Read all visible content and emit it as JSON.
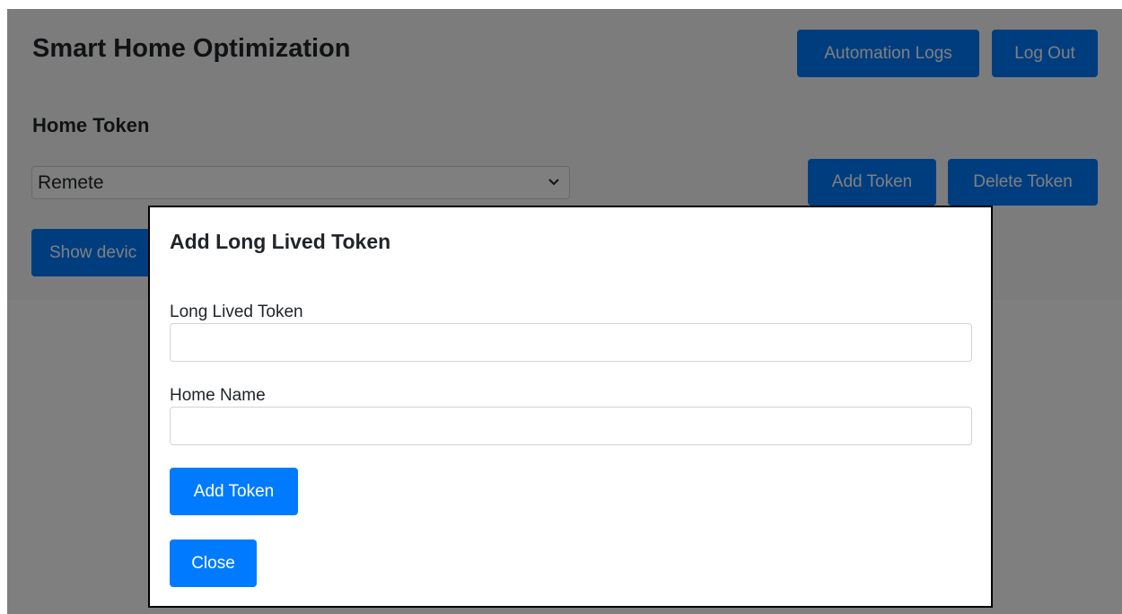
{
  "app": {
    "title": "Smart Home Optimization"
  },
  "header": {
    "automation_logs_label": "Automation Logs",
    "logout_label": "Log Out"
  },
  "home_token": {
    "section_label": "Home Token",
    "selected_value": "Remete",
    "add_token_label": "Add Token",
    "delete_token_label": "Delete Token",
    "show_devices_label": "Show devic"
  },
  "modal": {
    "title": "Add Long Lived Token",
    "long_lived_token_label": "Long Lived Token",
    "long_lived_token_value": "",
    "home_name_label": "Home Name",
    "home_name_value": "",
    "add_token_label": "Add Token",
    "close_label": "Close"
  },
  "colors": {
    "primary": "#007bff",
    "overlay": "rgba(0,0,0,0.5)",
    "modal_border": "#000000"
  },
  "icons": {
    "select_chevron": "chevron-down-icon"
  }
}
